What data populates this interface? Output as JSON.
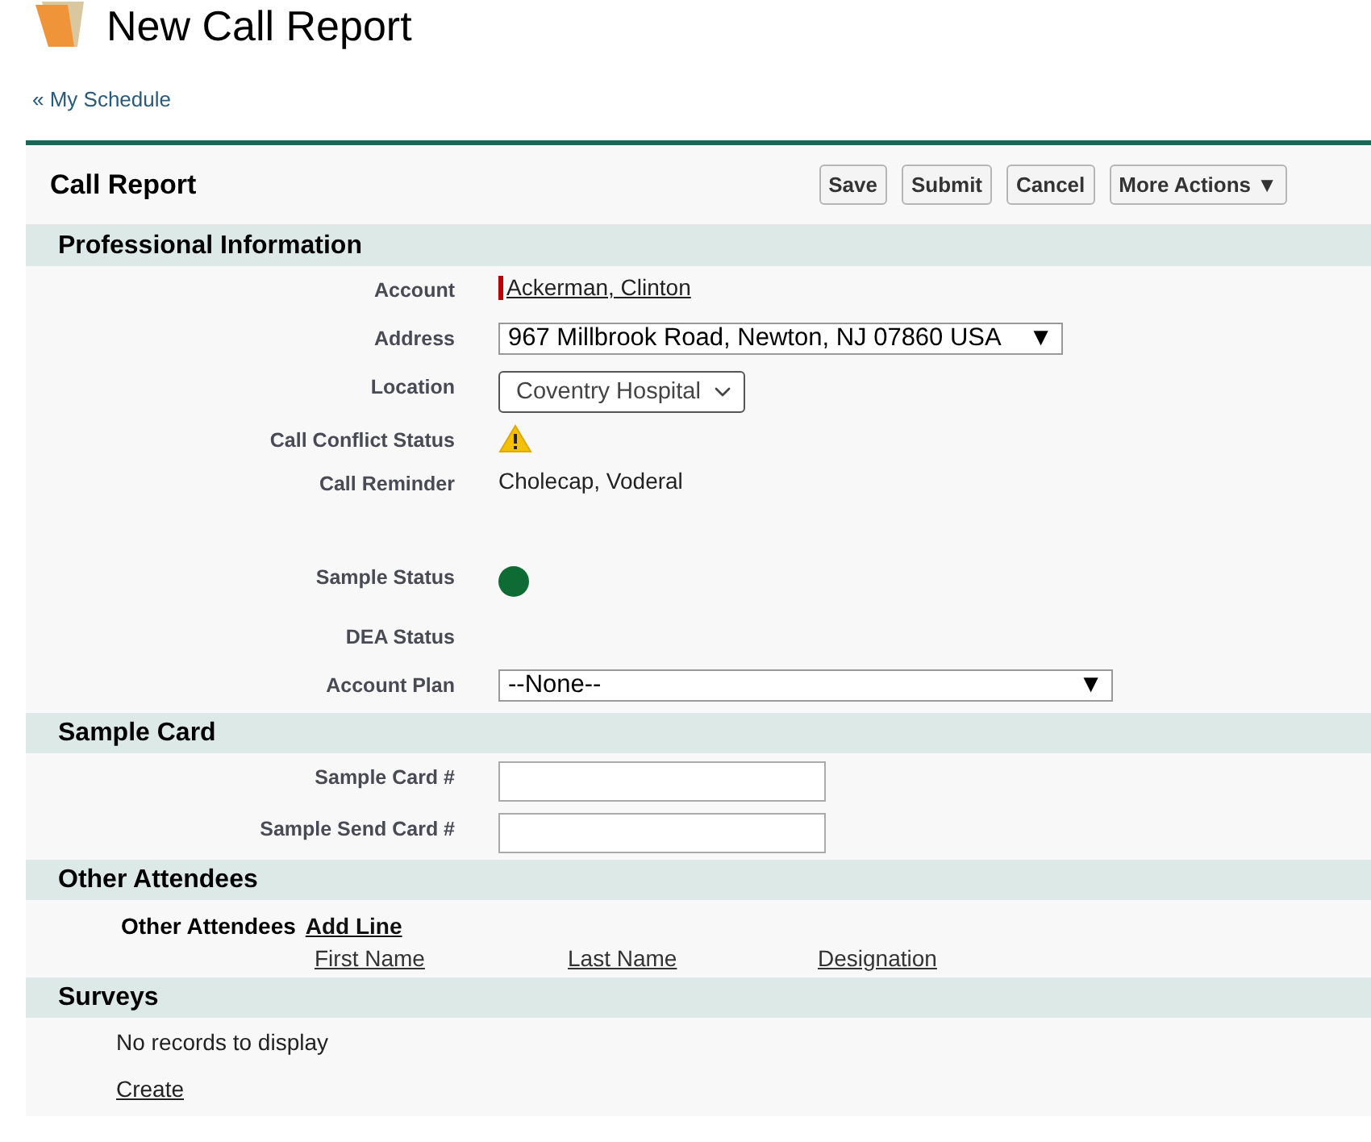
{
  "page_title": "New Call Report",
  "back_link": "« My Schedule",
  "panel": {
    "title": "Call Report",
    "buttons": [
      "Save",
      "Submit",
      "Cancel",
      "More Actions ▼"
    ]
  },
  "sections": [
    {
      "title": "Professional Information",
      "kind": "fields",
      "fields": [
        {
          "label": "Account",
          "kind": "link",
          "value": "Ackerman, Clinton"
        },
        {
          "label": "Address",
          "kind": "select",
          "value": "967 Millbrook Road, Newton, NJ 07860 USA",
          "arrow": "▼"
        },
        {
          "label": "Location",
          "kind": "dropdown",
          "value": "Coventry Hospital"
        },
        {
          "label": "Call Conflict Status",
          "kind": "warning"
        },
        {
          "label": "Call Reminder",
          "kind": "text",
          "value": "Cholecap, Voderal"
        },
        {
          "label": "Sample Status",
          "kind": "dot",
          "color": "#0e6b34"
        },
        {
          "label": "DEA Status",
          "kind": "empty"
        },
        {
          "label": "Account Plan",
          "kind": "wide-select",
          "value": "--None--",
          "arrow": "▼"
        }
      ]
    },
    {
      "title": "Sample Card",
      "kind": "fields",
      "fields": [
        {
          "label": "Sample Card #",
          "kind": "input"
        },
        {
          "label": "Sample Send Card #",
          "kind": "input"
        }
      ]
    },
    {
      "title": "Other Attendees",
      "kind": "attendees",
      "label": "Other Attendees",
      "action": "Add Line",
      "columns": [
        "First Name",
        "Last Name",
        "Designation"
      ]
    },
    {
      "title": "Surveys",
      "kind": "list",
      "message": "No records to display",
      "action": "Create"
    }
  ]
}
